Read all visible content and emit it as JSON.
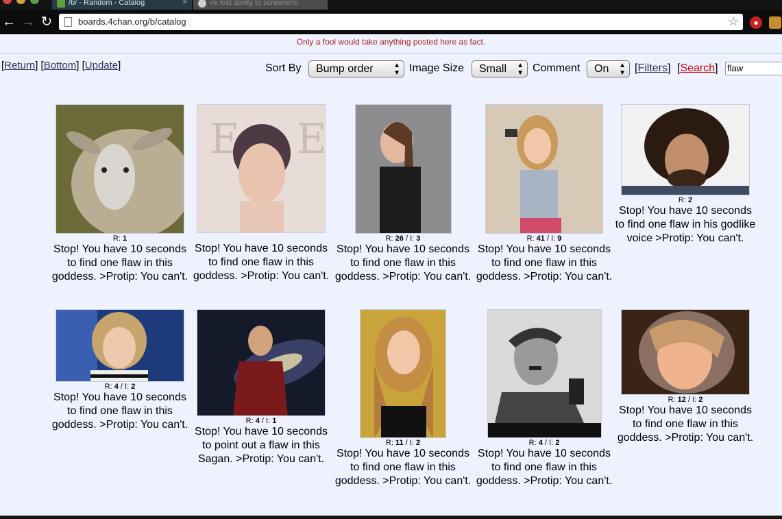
{
  "browser": {
    "tabs": [
      {
        "label": "/b/ - Random - Catalog",
        "active": true
      },
      {
        "label": "ve lost ability to screensho",
        "active": false
      }
    ],
    "url": "boards.4chan.org/b/catalog"
  },
  "page": {
    "disclaimer": "Only a fool would take anything posted here as fact.",
    "nav_links": {
      "return": "Return",
      "bottom": "Bottom",
      "update": "Update"
    },
    "controls": {
      "sort_label": "Sort By",
      "sort_value": "Bump order",
      "image_size_label": "Image Size",
      "image_size_value": "Small",
      "comment_label": "Comment",
      "comment_value": "On",
      "filters_label": "Filters",
      "search_label": "Search",
      "search_value": "flaw"
    }
  },
  "threads": [
    {
      "subject": "sheep",
      "replies": "1",
      "images": "",
      "teaser": "Stop! You have 10 seconds to find one flaw in this goddess. >Protip: You can't."
    },
    {
      "subject": "woman",
      "replies": "",
      "images": "",
      "teaser": "Stop! You have 10 seconds to find one flaw in this goddess. >Protip: You can't."
    },
    {
      "subject": "woman",
      "replies": "26",
      "images": "3",
      "teaser": "Stop! You have 10 seconds to find one flaw in this goddess. >Protip: You can't."
    },
    {
      "subject": "woman",
      "replies": "41",
      "images": "9",
      "teaser": "Stop! You have 10 seconds to find one flaw in this goddess. >Protip: You can't."
    },
    {
      "subject": "man",
      "replies": "2",
      "images": "",
      "teaser": "Stop! You have 10 seconds to find one flaw in his godlike voice >Protip: You can't."
    },
    {
      "subject": "woman",
      "replies": "4",
      "images": "2",
      "teaser": "Stop! You have 10 seconds to find one flaw in this goddess. >Protip: You can't."
    },
    {
      "subject": "man",
      "replies": "4",
      "images": "1",
      "teaser": "Stop! You have 10 seconds to point out a flaw in this Sagan. >Protip: You can't."
    },
    {
      "subject": "woman",
      "replies": "11",
      "images": "2",
      "teaser": "Stop! You have 10 seconds to find one flaw in this goddess. >Protip: You can't."
    },
    {
      "subject": "man",
      "replies": "4",
      "images": "2",
      "teaser": "Stop! You have 10 seconds to find one flaw in this goddess. >Protip: You can't."
    },
    {
      "subject": "woman",
      "replies": "12",
      "images": "2",
      "teaser": "Stop! You have 10 seconds to find one flaw in this goddess. >Protip: You can't."
    }
  ],
  "labels": {
    "replies_prefix": "R:",
    "images_sep": " / I: "
  }
}
